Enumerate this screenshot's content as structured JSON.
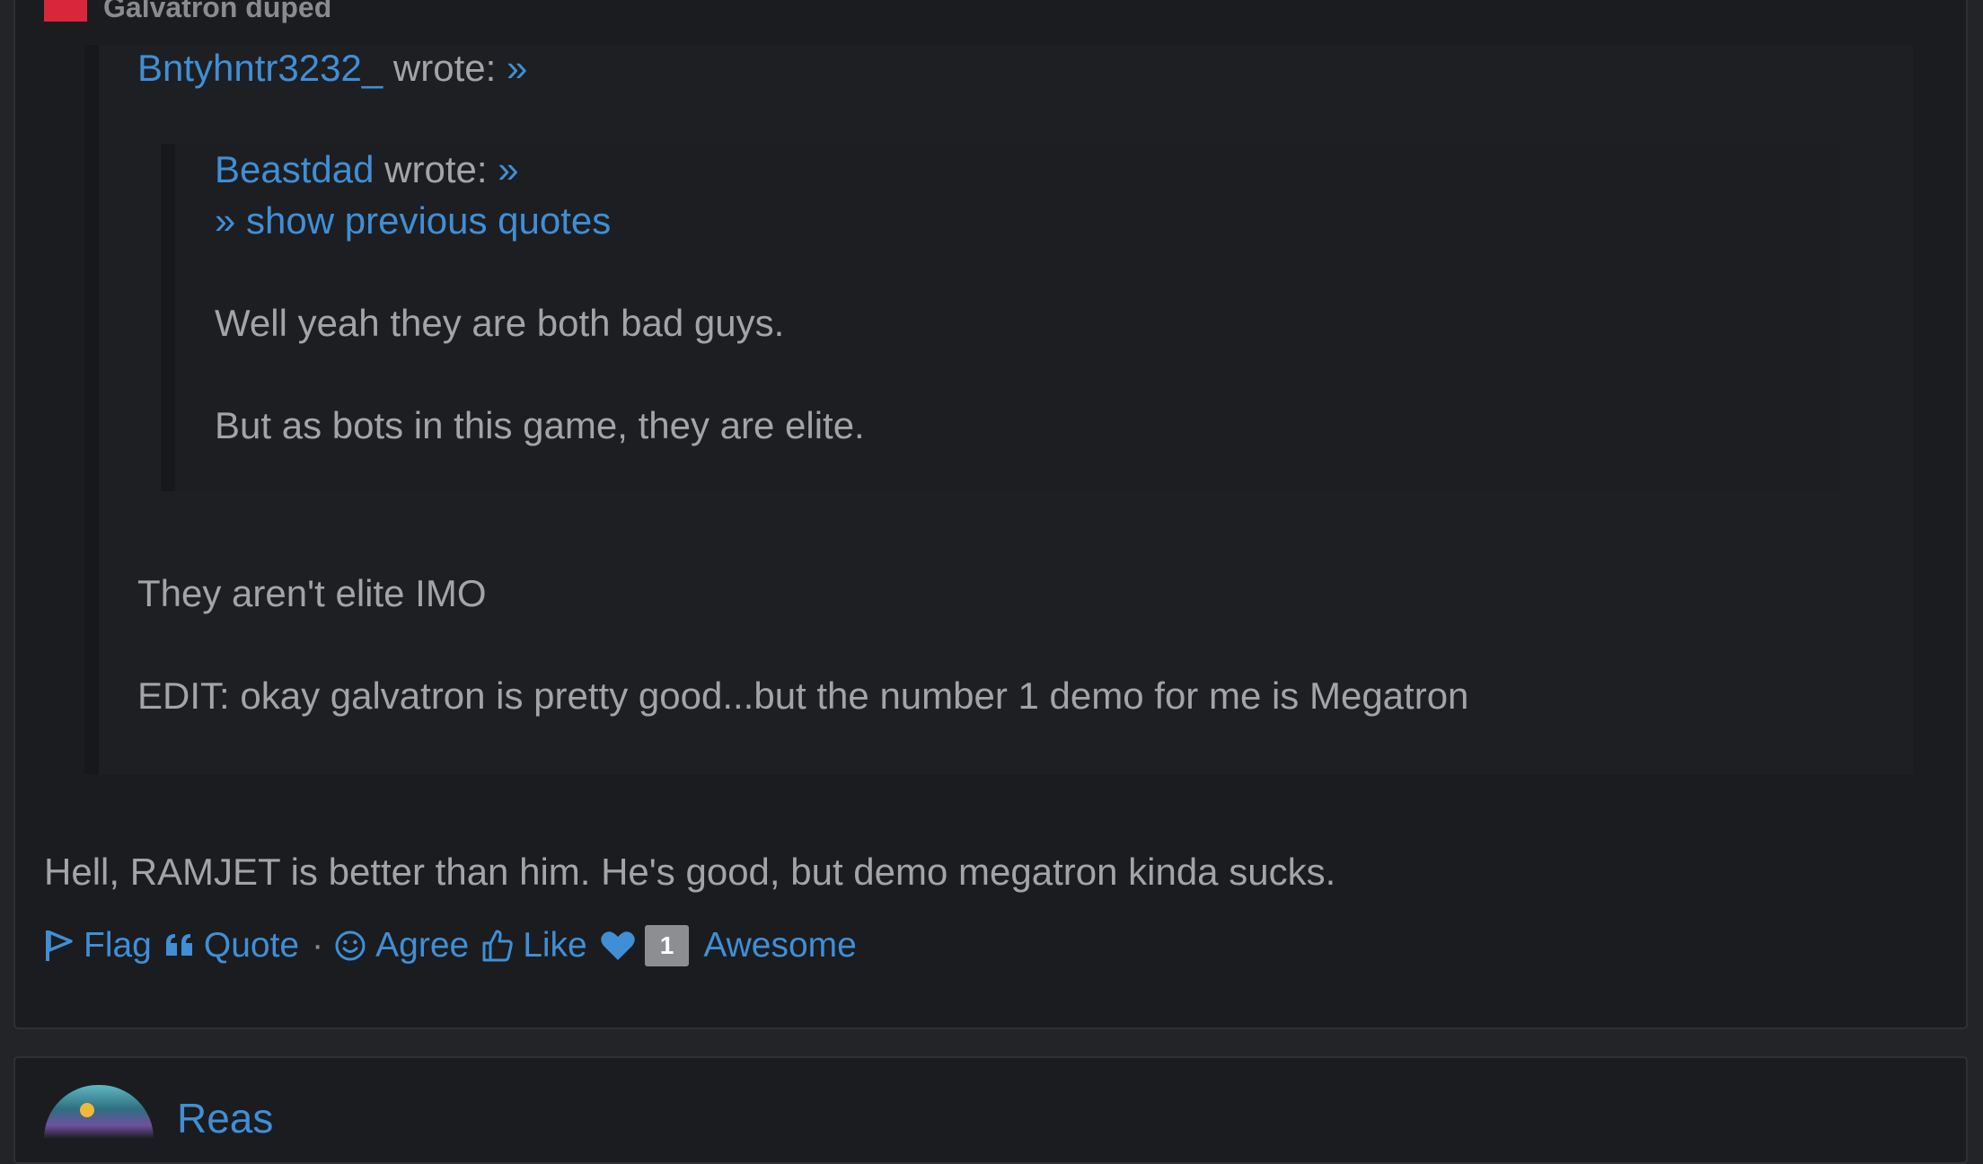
{
  "post1": {
    "header_user": "Galvatron duped",
    "outer_quote": {
      "author": "Bntyhntr3232_",
      "wrote": "wrote:",
      "jump": "»",
      "inner_quote": {
        "author": "Beastdad",
        "wrote": "wrote:",
        "jump": "»",
        "show_previous": "» show previous quotes",
        "lines": [
          "Well yeah they are both bad guys.",
          "But as bots in this game, they are elite."
        ]
      },
      "lines": [
        "They aren't elite IMO",
        "EDIT: okay galvatron is pretty good...but the number 1 demo for me is Megatron"
      ]
    },
    "reply": "Hell, RAMJET is better than him. He's good, but demo megatron kinda sucks.",
    "actions": {
      "flag": "Flag",
      "quote": "Quote",
      "separator": "·",
      "agree": "Agree",
      "like": "Like",
      "awesome_count": "1",
      "awesome": "Awesome"
    }
  },
  "post2": {
    "username": "Reas"
  },
  "colors": {
    "link": "#3f8fd6",
    "background": "#1b1c1f",
    "text": "#a3a4a8",
    "badge": "#8d8e92",
    "header_square": "#d9263b"
  }
}
